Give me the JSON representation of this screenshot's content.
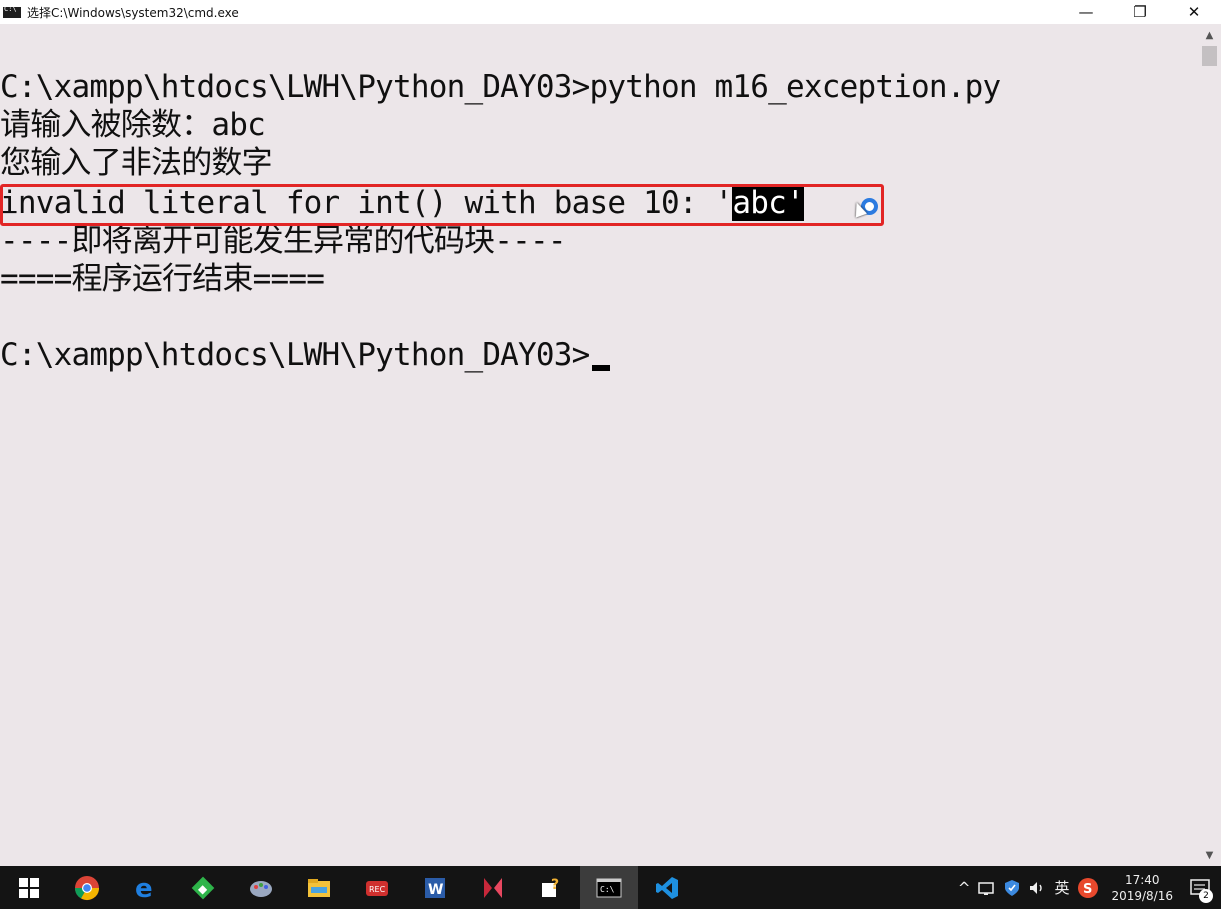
{
  "window": {
    "title": "选择C:\\Windows\\system32\\cmd.exe",
    "minimize": "—",
    "restore": "❐",
    "close": "✕"
  },
  "console": {
    "line1": "C:\\xampp\\htdocs\\LWH\\Python_DAY03>python m16_exception.py",
    "line2": "请输入被除数：abc",
    "line3": "您输入了非法的数字",
    "line4_prefix": "invalid literal for int() with base 10: '",
    "line4_selected": "abc'",
    "line5": "----即将离开可能发生异常的代码块----",
    "line6": "====程序运行结束====",
    "line7": "",
    "line8": "C:\\xampp\\htdocs\\LWH\\Python_DAY03>"
  },
  "taskbar": {
    "apps": [
      {
        "name": "start-icon",
        "color": "#ffffff"
      },
      {
        "name": "chrome-icon",
        "color": "#e0a020"
      },
      {
        "name": "edge-icon",
        "color": "#1f7fe0"
      },
      {
        "name": "git-icon",
        "color": "#2eb44a"
      },
      {
        "name": "paint-icon",
        "color": "#9aa8c0"
      },
      {
        "name": "file-explorer-icon",
        "color": "#f3c23a"
      },
      {
        "name": "recorder-icon",
        "color": "#d0302e"
      },
      {
        "name": "word-icon",
        "color": "#2b5ca8"
      },
      {
        "name": "media-icon",
        "color": "#c8283a"
      },
      {
        "name": "help-icon",
        "color": "#f2b233"
      },
      {
        "name": "cmd-icon",
        "color": "#2a2a2a"
      },
      {
        "name": "vscode-icon",
        "color": "#1e90e0"
      }
    ],
    "tray": {
      "chevron": "^",
      "ime": "英",
      "clock_time": "17:40",
      "clock_date": "2019/8/16",
      "notifications": "2"
    }
  }
}
